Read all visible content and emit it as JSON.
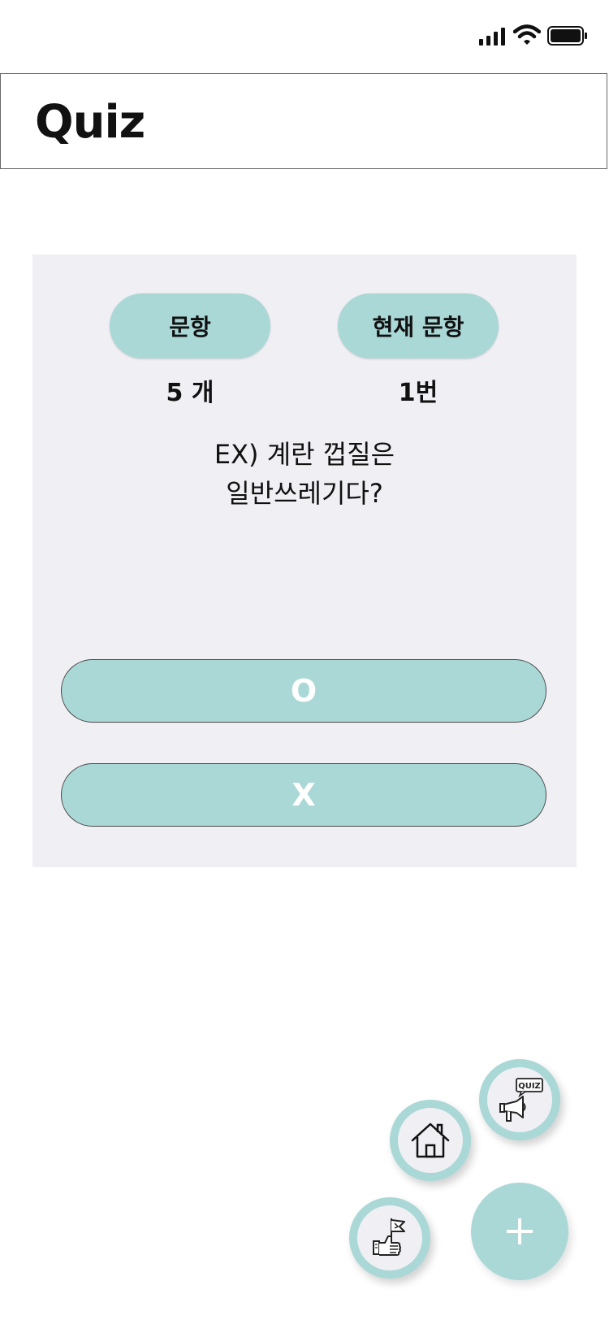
{
  "header": {
    "title": "Quiz"
  },
  "stats": {
    "count_label": "문항",
    "count_value": "5 개",
    "current_label": "현재 문항",
    "current_value": "1번"
  },
  "question": {
    "line1": "EX) 계란 껍질은",
    "line2": "일반쓰레기다?"
  },
  "answers": {
    "o": "O",
    "x": "X"
  },
  "fab": {
    "quiz_icon_text": "QUIZ",
    "icons": [
      "megaphone-quiz-icon",
      "home-icon",
      "thumbs-up-flag-icon",
      "plus-icon"
    ]
  },
  "colors": {
    "accent": "#a9d8d6",
    "card_bg": "#f0eff4"
  }
}
